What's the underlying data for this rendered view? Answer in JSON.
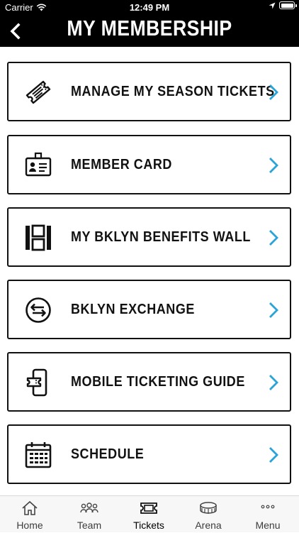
{
  "status_bar": {
    "carrier": "Carrier",
    "time": "12:49 PM"
  },
  "header": {
    "title": "MY MEMBERSHIP"
  },
  "menu": {
    "items": [
      {
        "label": "MANAGE MY SEASON TICKETS",
        "icon": "ticket-icon"
      },
      {
        "label": "MEMBER CARD",
        "icon": "id-badge-icon"
      },
      {
        "label": "MY BKLYN BENEFITS WALL",
        "icon": "benefits-wall-icon"
      },
      {
        "label": "BKLYN EXCHANGE",
        "icon": "exchange-arrows-icon"
      },
      {
        "label": "MOBILE TICKETING GUIDE",
        "icon": "mobile-ticket-icon"
      },
      {
        "label": "SCHEDULE",
        "icon": "calendar-icon"
      }
    ]
  },
  "tab_bar": {
    "active": "Tickets",
    "tabs": [
      {
        "label": "Home",
        "icon": "home-icon"
      },
      {
        "label": "Team",
        "icon": "team-icon"
      },
      {
        "label": "Tickets",
        "icon": "tickets-icon"
      },
      {
        "label": "Arena",
        "icon": "arena-icon"
      },
      {
        "label": "Menu",
        "icon": "more-dots-icon"
      }
    ]
  },
  "colors": {
    "header_bg": "#000000",
    "chevron": "#2aa3d8",
    "text": "#111111",
    "tab_bar_bg": "#f7f7f7"
  }
}
